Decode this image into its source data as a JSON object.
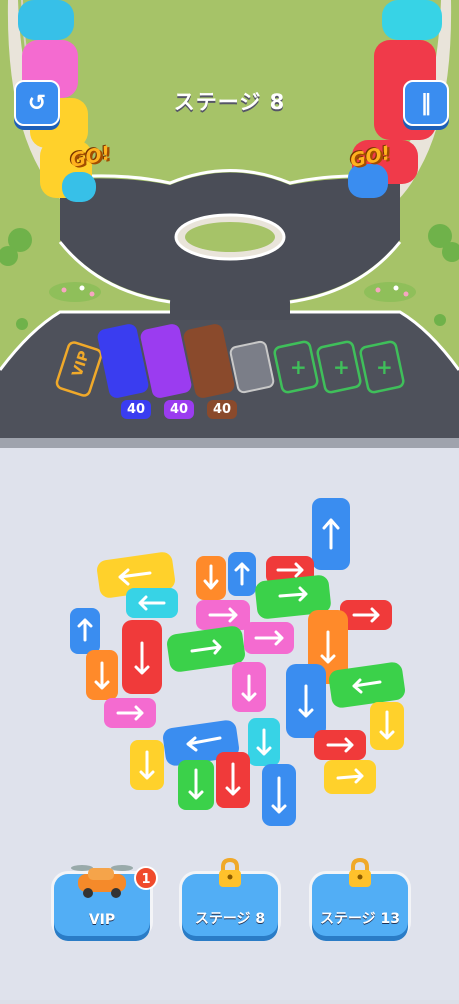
{
  "header": {
    "stage_title": "ステージ 8",
    "restart_icon": "restart-icon",
    "pause_icon": "pause-icon"
  },
  "go_labels": [
    "GO!",
    "GO!"
  ],
  "parking": {
    "vip_label": "VIP",
    "slots": [
      {
        "color": "#3a3df0",
        "count": "40"
      },
      {
        "color": "#9b3cf0",
        "count": "40"
      },
      {
        "color": "#8a4a2c",
        "count": "40"
      }
    ]
  },
  "bottom_buttons": [
    {
      "label": "VIP",
      "icon": "vip-car-icon",
      "badge": "1"
    },
    {
      "label": "ステージ 8",
      "icon": "lock-icon"
    },
    {
      "label": "ステージ 13",
      "icon": "lock-icon"
    }
  ],
  "colors": {
    "blue": "#3a8df0",
    "yellow": "#ffd12b",
    "cyan": "#37d3e6",
    "orange": "#ff8a2a",
    "red": "#f03a3a",
    "pink": "#f46bd0",
    "green": "#3bd14a"
  }
}
